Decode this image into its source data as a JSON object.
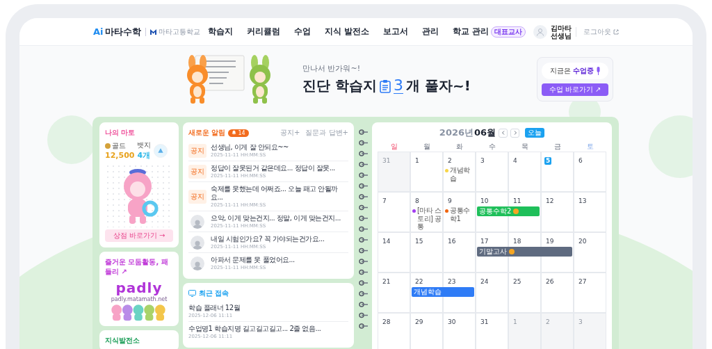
{
  "header": {
    "logo_prefix": "Ai",
    "logo": "마타수학",
    "school": "마타고등학교",
    "nav": [
      {
        "label": "학습지"
      },
      {
        "label": "커리큘럼"
      },
      {
        "label": "수업"
      },
      {
        "label": "지식 발전소"
      },
      {
        "label": "보고서"
      },
      {
        "label": "관리"
      },
      {
        "label": "학교 관리",
        "badge": "대표교사"
      }
    ],
    "user": {
      "name": "김마타",
      "role": "선생님"
    },
    "logout": "로그아웃"
  },
  "hero": {
    "greeting": "만나서 반가워~!",
    "title": "진단 학습지",
    "count": "3",
    "suffix": "개 풀자~!",
    "status_label": "지금은",
    "status": "수업중",
    "class_button": "수업 바로가기 ↗"
  },
  "my_mato": {
    "title": "나의 마토",
    "gold_label": "골드",
    "gold": "12,500",
    "badge_label": "뱃지",
    "badges": "4개",
    "shop_button": "상점 바로가기 →"
  },
  "padly": {
    "title": "즐거운 모둠활동, 패들리 ↗",
    "logo": "padly",
    "url": "padly.matamath.net"
  },
  "knowledge": {
    "title": "지식발전소"
  },
  "notifications": {
    "title": "새로운 알림",
    "count": "14",
    "links": [
      "공지+",
      "질문과 답변+"
    ],
    "items": [
      {
        "kind": "notice",
        "tag": "공지",
        "text": "선생님, 이게 잘 안되요~~",
        "time": "2025-11-11 HH:MM:SS"
      },
      {
        "kind": "notice",
        "tag": "공지",
        "text": "정답이 잘못된거 같은데요... 정답이 잘못...",
        "time": "2025-11-11 HH:MM:SS"
      },
      {
        "kind": "notice",
        "tag": "공지",
        "text": "숙제를 못했는데 어쩌죠... 오늘 패고 안될까요...",
        "time": "2025-11-11 HH:MM:SS"
      },
      {
        "kind": "avatar",
        "text": "으악, 이게 맞는건지... 정말, 이게 맞는건지...",
        "time": "2025-11-11 HH:MM:SS"
      },
      {
        "kind": "avatar",
        "text": "내일 시험인가요? 꼭 가야되는건가요...",
        "time": "2025-11-11 HH:MM:SS"
      },
      {
        "kind": "avatar",
        "text": "아파서 문제를 못 풀었어요...",
        "time": "2025-11-11 HH:MM:SS"
      }
    ]
  },
  "recent": {
    "title": "최근 접속",
    "items": [
      {
        "title": "학습 플래너 12월",
        "time": "2025-12-06 11:11"
      },
      {
        "title": "수업명1 학습지명 길고길고길고... 2줄 없음...",
        "time": "2025-12-06 11:11"
      }
    ]
  },
  "calendar": {
    "year": "2026년",
    "month": "06월",
    "today_button": "오늘",
    "weekdays": [
      {
        "label": "일",
        "kind": "sunday"
      },
      {
        "label": "월",
        "kind": "weekday"
      },
      {
        "label": "화",
        "kind": "weekday"
      },
      {
        "label": "수",
        "kind": "weekday"
      },
      {
        "label": "목",
        "kind": "weekday"
      },
      {
        "label": "금",
        "kind": "weekday"
      },
      {
        "label": "토",
        "kind": "saturday"
      }
    ],
    "weeks": [
      {
        "cells": [
          {
            "day": "31",
            "other_month": true,
            "today": false
          },
          {
            "day": "1",
            "other_month": false,
            "today": false
          },
          {
            "day": "2",
            "other_month": false,
            "today": false,
            "events": [
              {
                "kind": "dot",
                "label": "개념학습",
                "color": "#f8d548"
              }
            ]
          },
          {
            "day": "3",
            "other_month": false,
            "today": false
          },
          {
            "day": "4",
            "other_month": false,
            "today": false
          },
          {
            "day": "5",
            "other_month": false,
            "today": true
          },
          {
            "day": "6",
            "other_month": false,
            "today": false
          }
        ]
      },
      {
        "cells": [
          {
            "day": "7",
            "other_month": false,
            "today": false
          },
          {
            "day": "8",
            "other_month": false,
            "today": false,
            "events": [
              {
                "kind": "dot",
                "label": "[마타 스토리] 공통",
                "color": "#a23df0"
              }
            ]
          },
          {
            "day": "9",
            "other_month": false,
            "today": false,
            "events": [
              {
                "kind": "dot",
                "label": "공통수학1",
                "color": "#f0650f"
              }
            ]
          },
          {
            "day": "10",
            "other_month": false,
            "today": false,
            "events": [
              {
                "kind": "bar",
                "label": "공통수학2",
                "color": "#1fbf5a",
                "marker": true
              }
            ]
          },
          {
            "day": "11",
            "other_month": false,
            "today": false,
            "continues": true
          },
          {
            "day": "12",
            "other_month": false,
            "today": false
          },
          {
            "day": "13",
            "other_month": false,
            "today": false
          }
        ]
      },
      {
        "cells": [
          {
            "day": "14",
            "other_month": false,
            "today": false
          },
          {
            "day": "15",
            "other_month": false,
            "today": false
          },
          {
            "day": "16",
            "other_month": false,
            "today": false
          },
          {
            "day": "17",
            "other_month": false,
            "today": false,
            "events": [
              {
                "kind": "bar",
                "label": "기말고사",
                "color": "#5f6b80",
                "marker": true
              }
            ]
          },
          {
            "day": "18",
            "other_month": false,
            "today": false,
            "continues": true
          },
          {
            "day": "19",
            "other_month": false,
            "today": false,
            "continues": true
          },
          {
            "day": "20",
            "other_month": false,
            "today": false
          }
        ]
      },
      {
        "cells": [
          {
            "day": "21",
            "other_month": false,
            "today": false
          },
          {
            "day": "22",
            "other_month": false,
            "today": false,
            "events": [
              {
                "kind": "bar",
                "label": "개념학습",
                "color": "#2f7cf6",
                "marker": false
              }
            ]
          },
          {
            "day": "23",
            "other_month": false,
            "today": false,
            "continues": true
          },
          {
            "day": "24",
            "other_month": false,
            "today": false
          },
          {
            "day": "25",
            "other_month": false,
            "today": false
          },
          {
            "day": "26",
            "other_month": false,
            "today": false
          },
          {
            "day": "27",
            "other_month": false,
            "today": false
          }
        ]
      },
      {
        "cells": [
          {
            "day": "28",
            "other_month": false,
            "today": false
          },
          {
            "day": "29",
            "other_month": false,
            "today": false
          },
          {
            "day": "30",
            "other_month": false,
            "today": false
          },
          {
            "day": "31",
            "other_month": false,
            "today": false
          },
          {
            "day": "1",
            "other_month": true,
            "today": false
          },
          {
            "day": "2",
            "other_month": true,
            "today": false
          },
          {
            "day": "3",
            "other_month": true,
            "today": false
          }
        ]
      }
    ]
  }
}
